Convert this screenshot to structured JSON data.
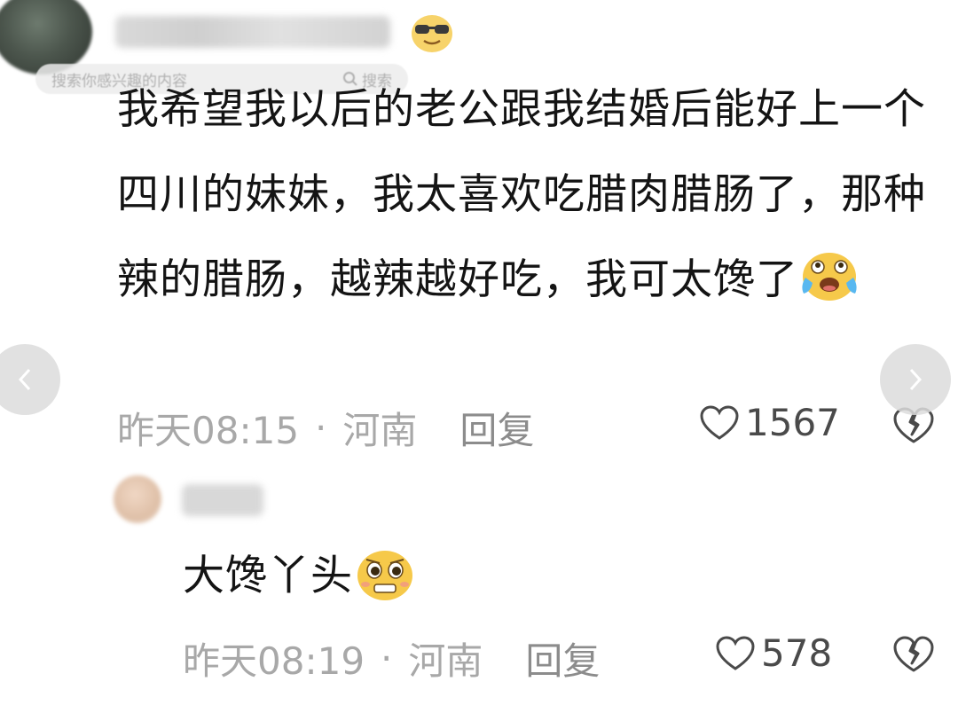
{
  "search": {
    "placeholder": "搜索你感兴趣的内容",
    "button_label": "搜索"
  },
  "comments": [
    {
      "text": "我希望我以后的老公跟我结婚后能好上一个四川的妹妹，我太喜欢吃腊肉腊肠了，那种辣的腊肠，越辣越好吃，我可太馋了",
      "emoji": "crying-laughing-emoji",
      "time": "昨天08:15",
      "location": "河南",
      "reply_label": "回复",
      "likes": "1567"
    },
    {
      "text": "大馋丫头",
      "emoji": "pleading-smile-emoji",
      "time": "昨天08:19",
      "location": "河南",
      "reply_label": "回复",
      "likes": "578"
    }
  ],
  "meta_separator": "·",
  "colors": {
    "meta_text": "#a8a8a8",
    "body_text": "#141414",
    "accent_emoji": "#f6c94a"
  }
}
